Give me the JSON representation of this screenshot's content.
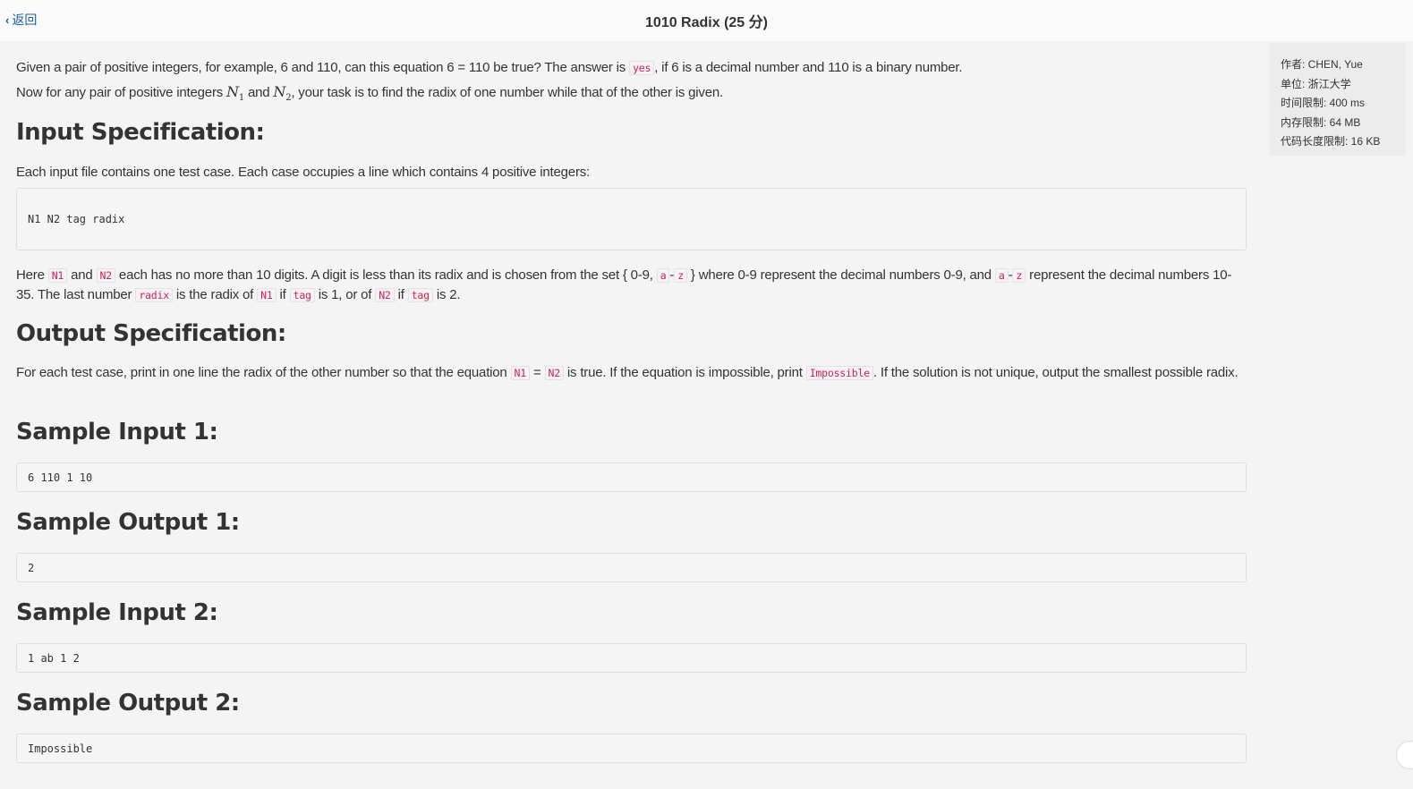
{
  "header": {
    "back_label": "返回",
    "title": "1010 Radix (25 分)"
  },
  "sidebar": {
    "author": "作者: CHEN, Yue",
    "unit": "单位: 浙江大学",
    "time_limit": "时间限制: 400 ms",
    "memory_limit": "内存限制: 64 MB",
    "code_limit": "代码长度限制: 16 KB"
  },
  "problem": {
    "intro1_a": "Given a pair of positive integers, for example, 6 and 110, can this equation 6 = 110 be true? The answer is ",
    "intro1_code": "yes",
    "intro1_b": ", if 6 is a decimal number and 110 is a binary number.",
    "intro2_a": "Now for any pair of positive integers ",
    "math_n1": "N",
    "math_n1_sub": "1",
    "intro2_b": " and ",
    "math_n2": "N",
    "math_n2_sub": "2",
    "intro2_c": ", your task is to find the radix of one number while that of the other is given.",
    "input_heading": "Input Specification:",
    "input_text": "Each input file contains one test case. Each case occupies a line which contains 4 positive integers:",
    "input_format": "N1 N2 tag radix",
    "here": "Here ",
    "code_n1": "N1",
    "and": " and ",
    "code_n2": "N2",
    "each_has": " each has no more than 10 digits. A digit is less than its radix and is chosen from the set { 0-9, ",
    "code_a": "a",
    "dash": "-",
    "code_z": "z",
    "where": " } where 0-9 represent the decimal numbers 0-9, and ",
    "represent": " represent the decimal numbers 10-35. The last number ",
    "code_radix": "radix",
    "is_radix_of": " is the radix of ",
    "if": " if ",
    "code_tag": "tag",
    "is1_or_of": " is 1, or of ",
    "is2": " is 2.",
    "output_heading": "Output Specification:",
    "output_a": "For each test case, print in one line the radix of the other number so that the equation ",
    "eq": " = ",
    "output_b": " is true. If the equation is impossible, print ",
    "code_impossible": "Impossible",
    "output_c": ". If the solution is not unique, output the smallest possible radix.",
    "sample_input_1_heading": "Sample Input 1:",
    "sample_input_1": "6 110 1 10",
    "sample_output_1_heading": "Sample Output 1:",
    "sample_output_1": "2",
    "sample_input_2_heading": "Sample Input 2:",
    "sample_input_2": "1 ab 1 2",
    "sample_output_2_heading": "Sample Output 2:",
    "sample_output_2": "Impossible"
  }
}
